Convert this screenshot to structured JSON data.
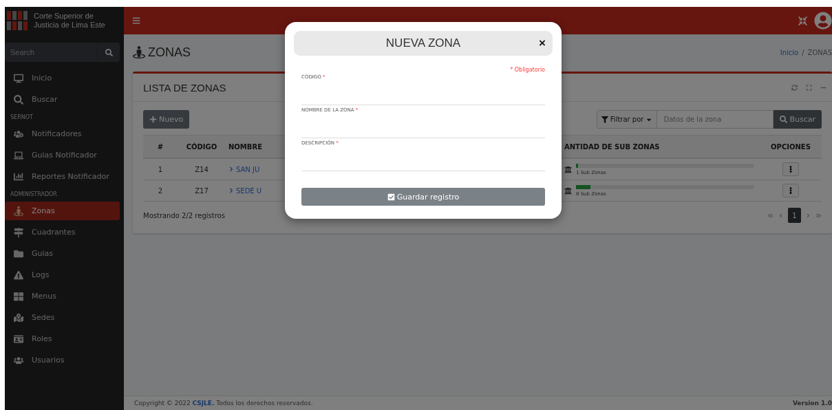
{
  "sidebar": {
    "brand_lines": [
      "Corte Superior de",
      "Justicia de Lima Este"
    ],
    "search": {
      "placeholder": "Search"
    },
    "sections": [
      {
        "items": [
          {
            "label": "Inicio",
            "selected": false
          },
          {
            "label": "Buscar",
            "selected": false
          }
        ]
      },
      {
        "title": "SERNOT",
        "items": [
          {
            "label": "Notificadores",
            "selected": false
          },
          {
            "label": "Guias Notificador",
            "selected": false
          },
          {
            "label": "Reportes Notificador",
            "selected": false
          }
        ]
      },
      {
        "title": "ADMINISTRADOR",
        "items": [
          {
            "label": "Zonas",
            "selected": true
          },
          {
            "label": "Cuadrantes",
            "selected": false
          },
          {
            "label": "Guias",
            "selected": false
          },
          {
            "label": "Logs",
            "selected": false
          },
          {
            "label": "Menus",
            "selected": false
          },
          {
            "label": "Sedes",
            "selected": false
          },
          {
            "label": "Roles",
            "selected": false
          },
          {
            "label": "Usuarios",
            "selected": false
          }
        ]
      }
    ]
  },
  "page": {
    "title": "ZONAS",
    "breadcrumb": [
      "Inicio",
      "ZONAS"
    ],
    "separator": "/"
  },
  "card": {
    "title": "LISTA DE ZONAS",
    "new_button": "Nuevo",
    "filter_button": "Filtrar por",
    "search_placeholder": "Datos de la zona",
    "search_button": "Buscar",
    "columns": [
      "#",
      "CÓDIGO",
      "NOMBRE",
      "ANTIDAD DE SUB ZONAS",
      "OPCIONES"
    ],
    "rows": [
      {
        "index": "1",
        "code": "Z14",
        "name": "SAN JU",
        "subzones": "1 Sub Zonas",
        "level": 0.01
      },
      {
        "index": "2",
        "code": "Z17",
        "name": "SEDE U",
        "subzones": "8 Sub Zonas",
        "level": 0.08
      }
    ],
    "summary": "Mostrando 2/2 registros",
    "pages": [
      {
        "label": "1",
        "selected": true
      }
    ]
  },
  "footer": {
    "copyright": "Copyright © 2022",
    "org": "CSJLE.",
    "rights": "Todos los derechos reservados.",
    "version": "Version 1.0"
  },
  "modal": {
    "title": "NUEVA ZONA",
    "close": "×",
    "required_note": "* Obligatorio",
    "fields": [
      {
        "label": "CÓDIGO",
        "mark": "*"
      },
      {
        "label": "NOMBRE DE LA ZONA",
        "mark": "*"
      },
      {
        "label": "DESCRIPCIÓN",
        "mark": "*"
      }
    ],
    "submit": "Guardar registro"
  }
}
